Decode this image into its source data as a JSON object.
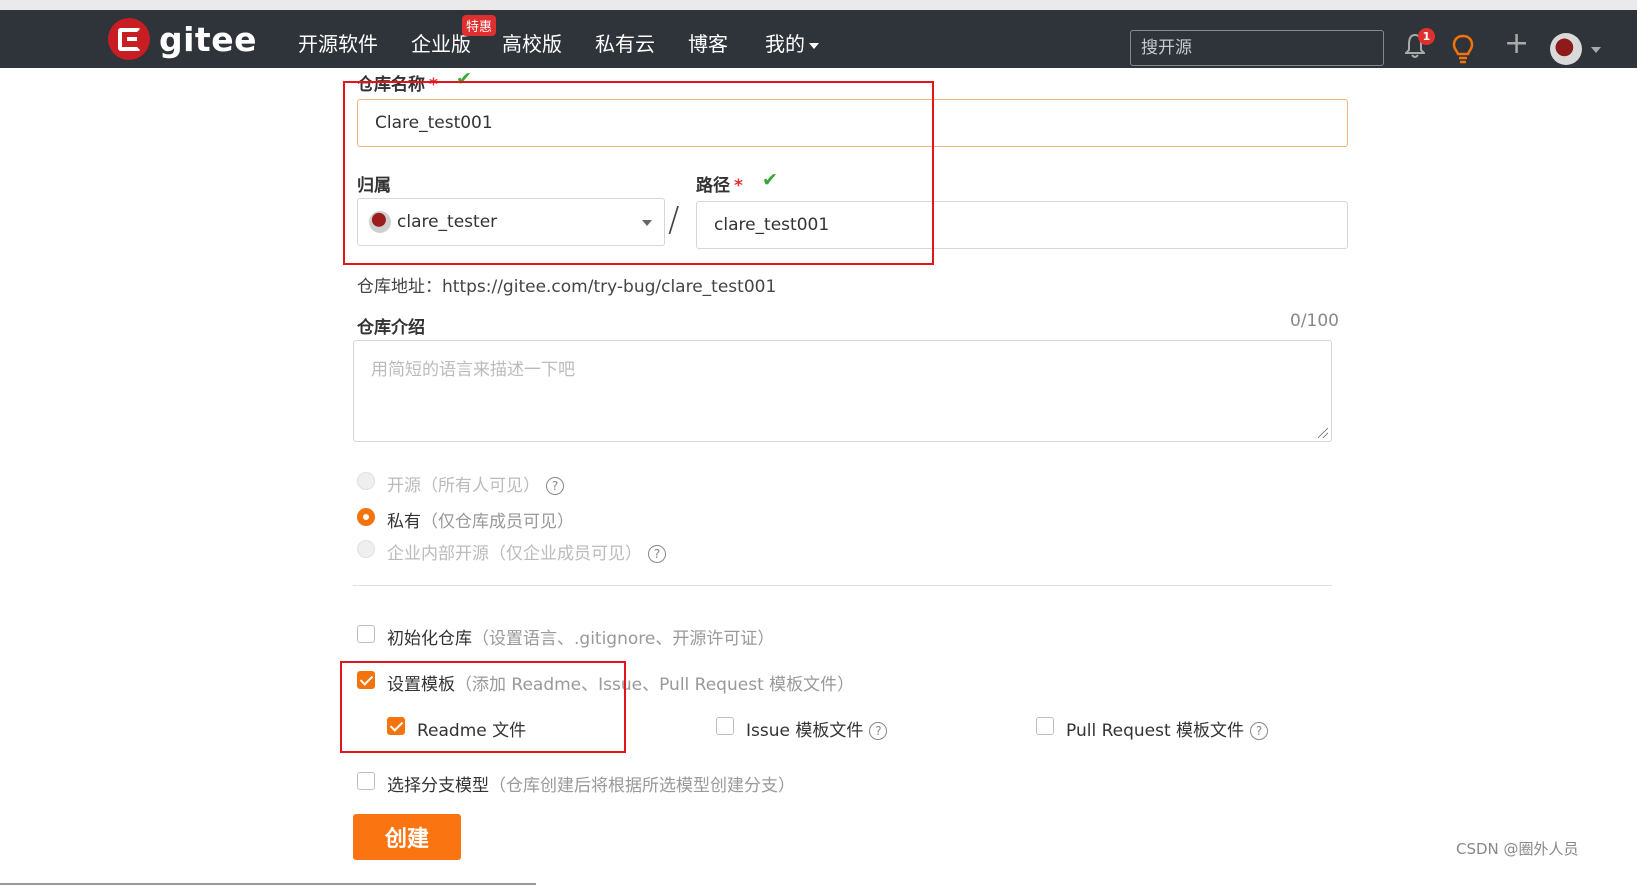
{
  "nav": {
    "brand": "gitee",
    "items": [
      "开源软件",
      "企业版",
      "高校版",
      "私有云",
      "博客",
      "我的"
    ],
    "badge": "特惠",
    "search_placeholder": "搜开源",
    "notification_count": "1"
  },
  "form": {
    "repo_name_label": "仓库名称",
    "required_mark": "*",
    "repo_name_value": "Clare_test001",
    "owner_label": "归属",
    "owner_value": "clare_tester",
    "separator": "/",
    "path_label": "路径",
    "path_value": "clare_test001",
    "repo_url": "仓库地址：https://gitee.com/try-bug/clare_test001",
    "desc_label": "仓库介绍",
    "desc_counter": "0/100",
    "desc_placeholder": "用简短的语言来描述一下吧",
    "visibility": [
      {
        "label": "开源",
        "hint": "（所有人可见）",
        "state": "disabled"
      },
      {
        "label": "私有",
        "hint": "（仅仓库成员可见）",
        "state": "selected"
      },
      {
        "label": "企业内部开源",
        "hint": "（仅企业成员可见）",
        "state": "disabled"
      }
    ],
    "init_repo_label": "初始化仓库",
    "init_repo_hint": "（设置语言、.gitignore、开源许可证）",
    "template_label": "设置模板",
    "template_hint": "（添加 Readme、Issue、Pull Request 模板文件）",
    "template_options": [
      "Readme 文件",
      "Issue 模板文件",
      "Pull Request 模板文件"
    ],
    "branch_model_label": "选择分支模型",
    "branch_model_hint": "（仓库创建后将根据所选模型创建分支）",
    "create_button": "创建"
  },
  "watermark": "CSDN @圈外人员",
  "colors": {
    "accent": "#fb7412",
    "nav_bg": "#2f333a",
    "annotation": "#e3141c",
    "success": "#3aa635"
  }
}
